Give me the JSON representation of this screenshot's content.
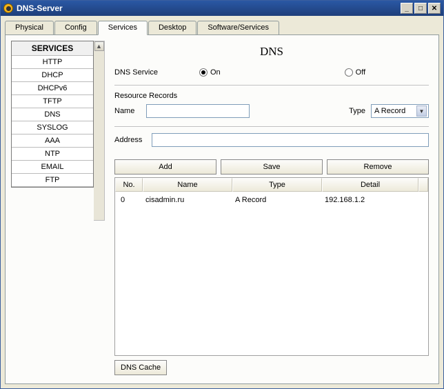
{
  "window": {
    "title": "DNS-Server"
  },
  "tabs": [
    {
      "label": "Physical",
      "active": false
    },
    {
      "label": "Config",
      "active": false
    },
    {
      "label": "Services",
      "active": true
    },
    {
      "label": "Desktop",
      "active": false
    },
    {
      "label": "Software/Services",
      "active": false
    }
  ],
  "sidebar": {
    "header": "SERVICES",
    "items": [
      {
        "label": "HTTP"
      },
      {
        "label": "DHCP"
      },
      {
        "label": "DHCPv6"
      },
      {
        "label": "TFTP"
      },
      {
        "label": "DNS"
      },
      {
        "label": "SYSLOG"
      },
      {
        "label": "AAA"
      },
      {
        "label": "NTP"
      },
      {
        "label": "EMAIL"
      },
      {
        "label": "FTP"
      }
    ]
  },
  "page": {
    "heading": "DNS",
    "service_label": "DNS Service",
    "on_label": "On",
    "off_label": "Off",
    "service_state": "on",
    "records_label": "Resource Records",
    "name_label": "Name",
    "name_value": "",
    "type_label": "Type",
    "type_value": "A Record",
    "address_label": "Address",
    "address_value": "",
    "buttons": {
      "add": "Add",
      "save": "Save",
      "remove": "Remove"
    },
    "table": {
      "columns": {
        "no": "No.",
        "name": "Name",
        "type": "Type",
        "detail": "Detail"
      },
      "rows": [
        {
          "no": "0",
          "name": "cisadmin.ru",
          "type": "A Record",
          "detail": "192.168.1.2"
        }
      ]
    },
    "dns_cache_button": "DNS Cache"
  }
}
